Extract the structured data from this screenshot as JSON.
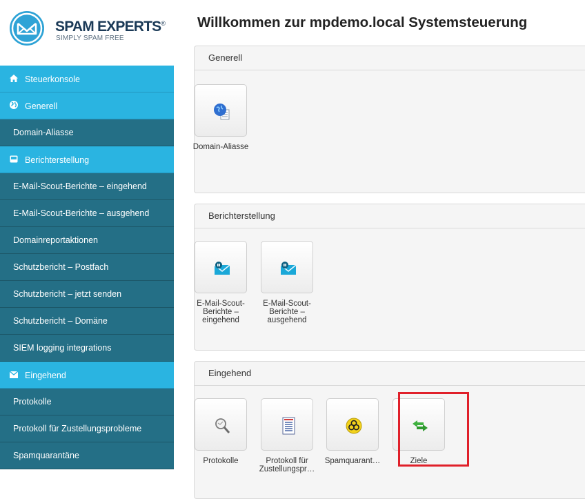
{
  "logo": {
    "brand": "SPAM EXPERTS",
    "registered": "®",
    "tagline": "SIMPLY SPAM FREE"
  },
  "sidebar": {
    "items": [
      {
        "label": "Steuerkonsole",
        "type": "head",
        "icon": "home-icon"
      },
      {
        "label": "Generell",
        "type": "head",
        "icon": "globe-icon"
      },
      {
        "label": "Domain-Aliasse",
        "type": "sub"
      },
      {
        "label": "Berichterstellung",
        "type": "head",
        "icon": "inbox-icon"
      },
      {
        "label": "E-Mail-Scout-Berichte – eingehend",
        "type": "sub"
      },
      {
        "label": "E-Mail-Scout-Berichte – ausgehend",
        "type": "sub"
      },
      {
        "label": "Domainreportaktionen",
        "type": "sub"
      },
      {
        "label": "Schutzbericht – Postfach",
        "type": "sub"
      },
      {
        "label": "Schutzbericht – jetzt senden",
        "type": "sub"
      },
      {
        "label": "Schutzbericht – Domäne",
        "type": "sub"
      },
      {
        "label": "SIEM logging integrations",
        "type": "sub"
      },
      {
        "label": "Eingehend",
        "type": "head",
        "icon": "envelope-icon"
      },
      {
        "label": "Protokolle",
        "type": "sub"
      },
      {
        "label": "Protokoll für Zustellungsprobleme",
        "type": "sub"
      },
      {
        "label": "Spamquarantäne",
        "type": "sub"
      }
    ]
  },
  "main": {
    "title": "Willkommen zur mpdemo.local Systemsteuerung",
    "panels": [
      {
        "title": "Generell",
        "tiles": [
          {
            "label": "Domain-Aliasse",
            "icon": "globe-document-icon"
          }
        ]
      },
      {
        "title": "Berichterstellung",
        "tiles": [
          {
            "label": "E-Mail-Scout-Berichte – eingehend",
            "icon": "mail-scout-icon"
          },
          {
            "label": "E-Mail-Scout-Berichte – ausgehend",
            "icon": "mail-scout-icon"
          }
        ]
      },
      {
        "title": "Eingehend",
        "tiles": [
          {
            "label": "Protokolle",
            "icon": "magnifier-icon"
          },
          {
            "label": "Protokoll für Zustellungspr…",
            "icon": "report-document-icon"
          },
          {
            "label": "Spamquarant…",
            "icon": "biohazard-icon"
          },
          {
            "label": "Ziele",
            "icon": "green-arrows-icon"
          }
        ]
      }
    ]
  },
  "colors": {
    "nav_head": "#2ab4e1",
    "nav_sub": "#246f86",
    "highlight": "#e0202a",
    "accent": "#2ea3d6"
  }
}
